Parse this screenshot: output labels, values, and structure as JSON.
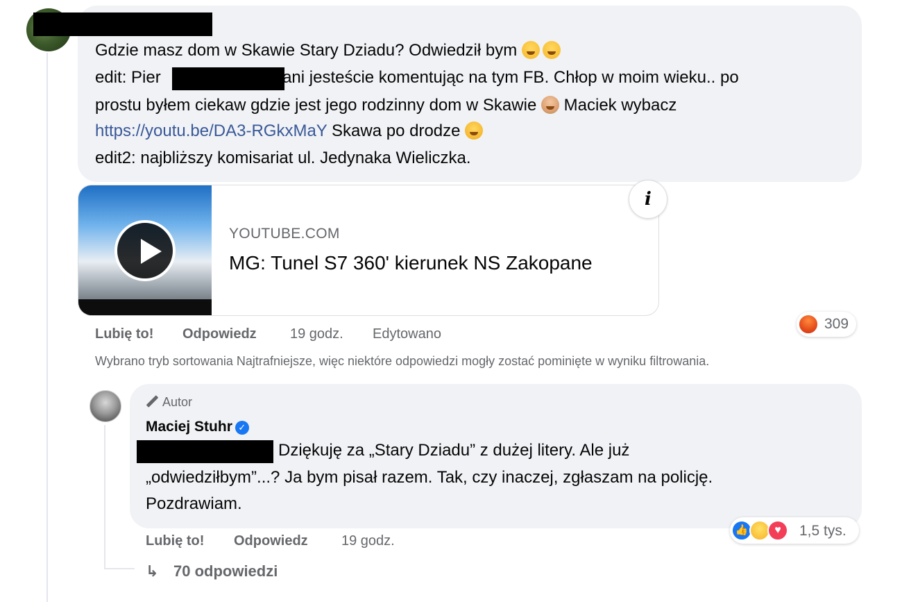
{
  "main_comment": {
    "lines": [
      "Gdzie masz dom w Skawie Stary Dziadu? Odwiedził bym",
      "edit: Pier",
      "bani jesteście komentując na tym FB. Chłop w moim wieku.. po",
      "prostu byłem ciekaw gdzie jest jego rodzinny dom w Skawie",
      "Maciek wybacz",
      "https://youtu.be/DA3-RGkxMaY",
      "Skawa po drodze",
      "edit2: najbliższy komisariat ul. Jedynaka Wieliczka."
    ],
    "link_preview": {
      "domain": "YOUTUBE.COM",
      "title": "MG: Tunel S7 360' kierunek NS Zakopane",
      "info_symbol": "i"
    },
    "actions": {
      "like": "Lubię to!",
      "reply": "Odpowiedz",
      "time": "19 godz.",
      "edited": "Edytowano"
    },
    "reactions": {
      "count": "309"
    }
  },
  "filter_note": "Wybrano tryb sortowania Najtrafniejsze, więc niektóre odpowiedzi mogły zostać pominięte w wyniku filtrowania.",
  "reply_comment": {
    "badge": "Autor",
    "author": "Maciej Stuhr",
    "lines": [
      "Dziękuję za „Stary Dziadu” z dużej litery. Ale już",
      "„odwiedziłbym”...? Ja bym pisał razem. Tak, czy inaczej, zgłaszam na policję.",
      "Pozdrawiam."
    ],
    "actions": {
      "like": "Lubię to!",
      "reply": "Odpowiedz",
      "time": "19 godz."
    },
    "reactions": {
      "count": "1,5 tys."
    }
  },
  "replies_link": "70 odpowiedzi",
  "icons": {
    "angry": "angry-reaction-icon",
    "like": "like-reaction-icon",
    "haha": "haha-reaction-icon",
    "love": "love-reaction-icon",
    "verified": "verified-badge-icon",
    "pencil": "pencil-icon",
    "reply_arrow": "reply-arrow-icon",
    "play": "play-icon"
  },
  "colors": {
    "bubble": "#f0f2f5",
    "secondary_text": "#65676b",
    "link": "#385898",
    "accent": "#1877f2"
  }
}
